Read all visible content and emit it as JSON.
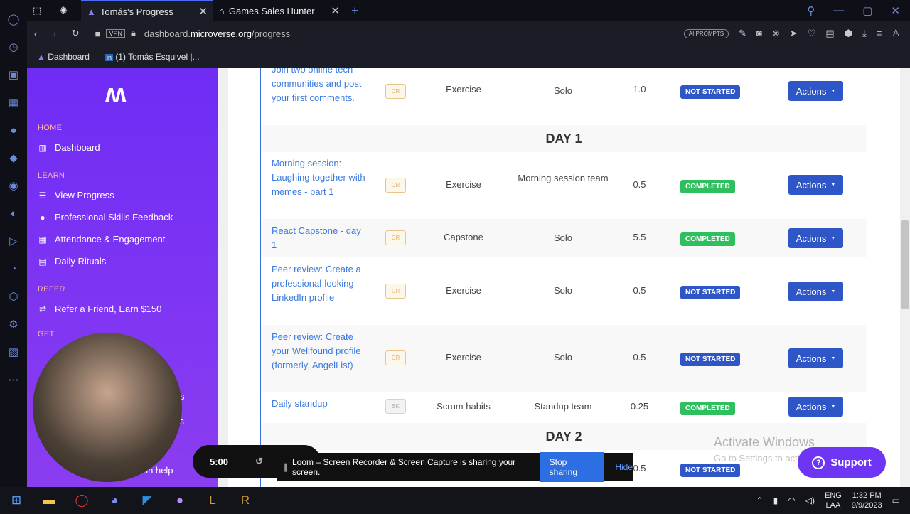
{
  "browser": {
    "tabs": [
      {
        "label": "Tomás's Progress",
        "active": true
      },
      {
        "label": "Games Sales Hunter",
        "active": false
      }
    ],
    "vpn": "VPN",
    "url_prefix": "dashboard.",
    "url_domain": "microverse.org",
    "url_path": "/progress",
    "ai_prompts": "AI PROMPTS",
    "bookmarks": [
      "Dashboard",
      "(1) Tomás Esquivel |..."
    ]
  },
  "sidebar": {
    "sections": [
      {
        "title": "HOME",
        "items": [
          {
            "label": "Dashboard",
            "icon": "columns-icon"
          }
        ]
      },
      {
        "title": "LEARN",
        "items": [
          {
            "label": "View Progress",
            "icon": "list-icon"
          },
          {
            "label": "Professional Skills Feedback",
            "icon": "user-icon"
          },
          {
            "label": "Attendance & Engagement",
            "icon": "calendar-icon"
          },
          {
            "label": "Daily Rituals",
            "icon": "note-icon"
          }
        ]
      },
      {
        "title": "REFER",
        "items": [
          {
            "label": "Refer a Friend, Earn $150",
            "icon": "retweet-icon"
          }
        ]
      }
    ],
    "partial_section": "GET",
    "partial_items": [
      "s",
      "rs",
      "ion help"
    ]
  },
  "table": {
    "rows": [
      {
        "title": "Join two online tech communities and post your first comments.",
        "badge": "CR",
        "type": "Exercise",
        "team": "Solo",
        "points": "1.0",
        "status": "NOT STARTED",
        "action": "Actions"
      },
      {
        "day": "DAY 1"
      },
      {
        "title": "Morning session: Laughing together with memes - part 1",
        "badge": "CR",
        "type": "Exercise",
        "team": "Morning session team",
        "points": "0.5",
        "status": "COMPLETED",
        "action": "Actions"
      },
      {
        "title": "React Capstone - day 1",
        "badge": "CR",
        "type": "Capstone",
        "team": "Solo",
        "points": "5.5",
        "status": "COMPLETED",
        "action": "Actions"
      },
      {
        "title": "Peer review: Create a professional-looking LinkedIn profile",
        "badge": "CR",
        "type": "Exercise",
        "team": "Solo",
        "points": "0.5",
        "status": "NOT STARTED",
        "action": "Actions"
      },
      {
        "title": "Peer review: Create your Wellfound profile (formerly, AngelList)",
        "badge": "CR",
        "type": "Exercise",
        "team": "Solo",
        "points": "0.5",
        "status": "NOT STARTED",
        "action": "Actions"
      },
      {
        "title": "Daily standup",
        "badge": "SK",
        "type": "Scrum habits",
        "team": "Standup team",
        "points": "0.25",
        "status": "COMPLETED",
        "action": "Actions"
      },
      {
        "day": "DAY 2"
      },
      {
        "points": "0.5",
        "status": "NOT STARTED"
      }
    ]
  },
  "overlay": {
    "timer": "5:00",
    "share_text": "Loom – Screen Recorder & Screen Capture is sharing your screen.",
    "stop": "Stop sharing",
    "hide": "Hide",
    "watermark_1": "Activate Windows",
    "watermark_2": "Go to Settings to activate Windows.",
    "support": "Support"
  },
  "taskbar": {
    "lang_1": "ENG",
    "lang_2": "LAA",
    "time": "1:32 PM",
    "date": "9/9/2023"
  },
  "colors": {
    "accent": "#2f56c7",
    "completed": "#2fbf5f",
    "sidebar": "#7a33f3"
  }
}
